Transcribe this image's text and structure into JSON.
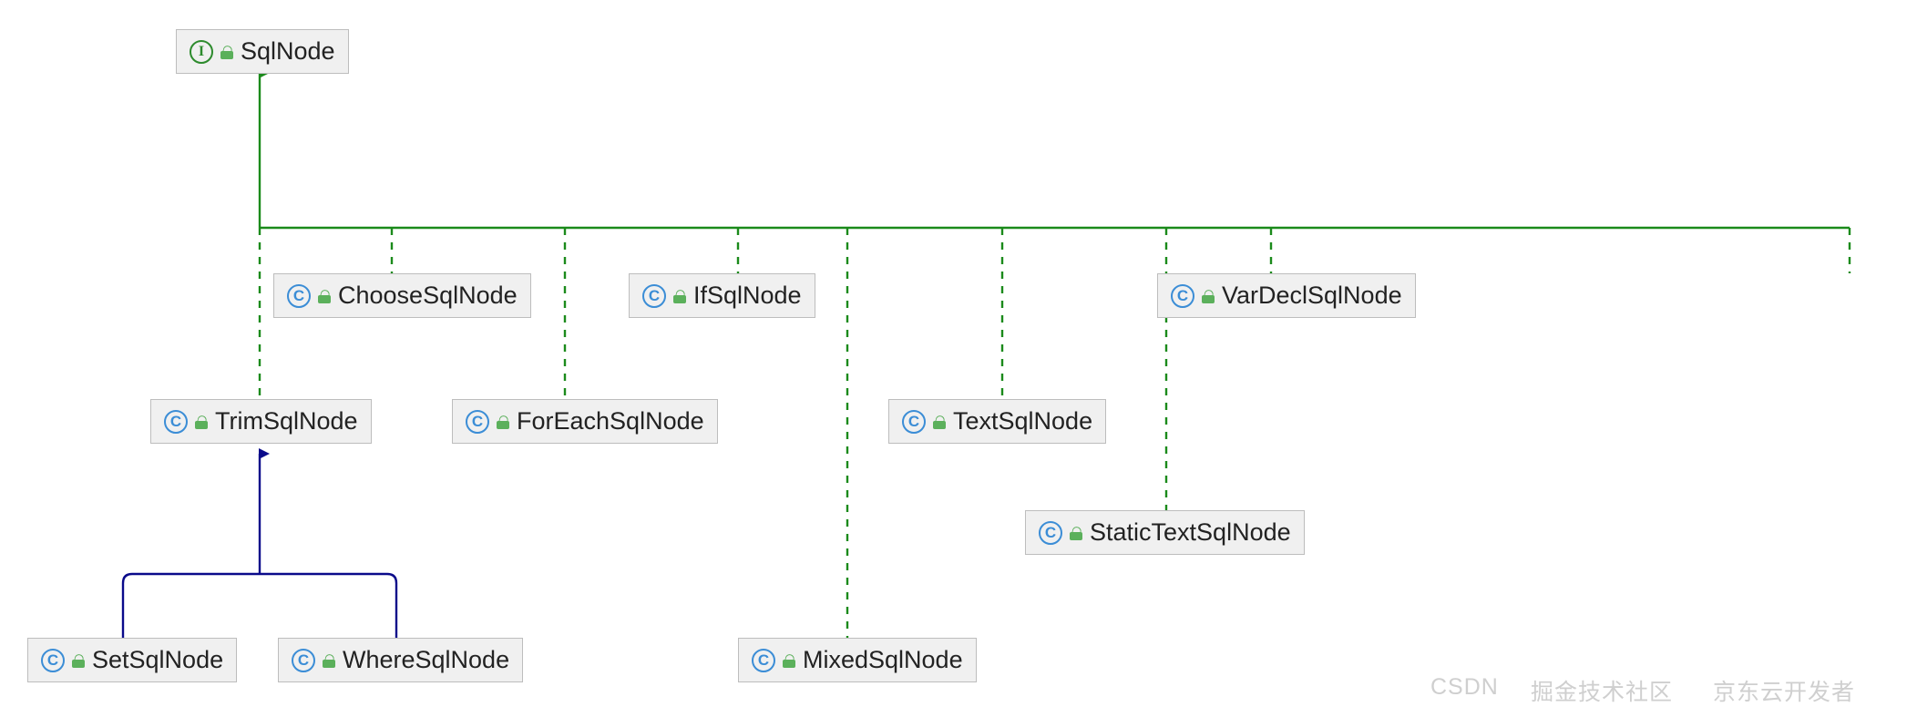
{
  "colors": {
    "node_bg": "#f0f0f0",
    "node_border": "#bdbdbd",
    "interface_green": "#2d8b2d",
    "class_blue": "#3b8dd6",
    "implements_line": "#1b8a1b",
    "extends_line": "#0a0a8a",
    "lock_green": "#5bb05b"
  },
  "watermarks": {
    "w1": "CSDN",
    "w2": "掘金技术社区",
    "w3": "京东云开发者"
  },
  "nodes": {
    "sqlnode": {
      "label": "SqlNode",
      "type": "interface"
    },
    "choosesqlnode": {
      "label": "ChooseSqlNode",
      "type": "class"
    },
    "ifsqlnode": {
      "label": "IfSqlNode",
      "type": "class"
    },
    "vardeclsqlnode": {
      "label": "VarDeclSqlNode",
      "type": "class"
    },
    "trimsqlnode": {
      "label": "TrimSqlNode",
      "type": "class"
    },
    "foreachsqlnode": {
      "label": "ForEachSqlNode",
      "type": "class"
    },
    "textsqlnode": {
      "label": "TextSqlNode",
      "type": "class"
    },
    "statictextsqlnode": {
      "label": "StaticTextSqlNode",
      "type": "class"
    },
    "setsqlnode": {
      "label": "SetSqlNode",
      "type": "class"
    },
    "wheresqlnode": {
      "label": "WhereSqlNode",
      "type": "class"
    },
    "mixedsqlnode": {
      "label": "MixedSqlNode",
      "type": "class"
    }
  },
  "chart_data": {
    "type": "class-hierarchy-diagram",
    "root": "SqlNode",
    "edges": [
      {
        "from": "ChooseSqlNode",
        "to": "SqlNode",
        "relation": "implements"
      },
      {
        "from": "IfSqlNode",
        "to": "SqlNode",
        "relation": "implements"
      },
      {
        "from": "VarDeclSqlNode",
        "to": "SqlNode",
        "relation": "implements"
      },
      {
        "from": "TrimSqlNode",
        "to": "SqlNode",
        "relation": "implements"
      },
      {
        "from": "ForEachSqlNode",
        "to": "SqlNode",
        "relation": "implements"
      },
      {
        "from": "TextSqlNode",
        "to": "SqlNode",
        "relation": "implements"
      },
      {
        "from": "StaticTextSqlNode",
        "to": "SqlNode",
        "relation": "implements"
      },
      {
        "from": "MixedSqlNode",
        "to": "SqlNode",
        "relation": "implements"
      },
      {
        "from": "SetSqlNode",
        "to": "TrimSqlNode",
        "relation": "extends"
      },
      {
        "from": "WhereSqlNode",
        "to": "TrimSqlNode",
        "relation": "extends"
      }
    ]
  }
}
